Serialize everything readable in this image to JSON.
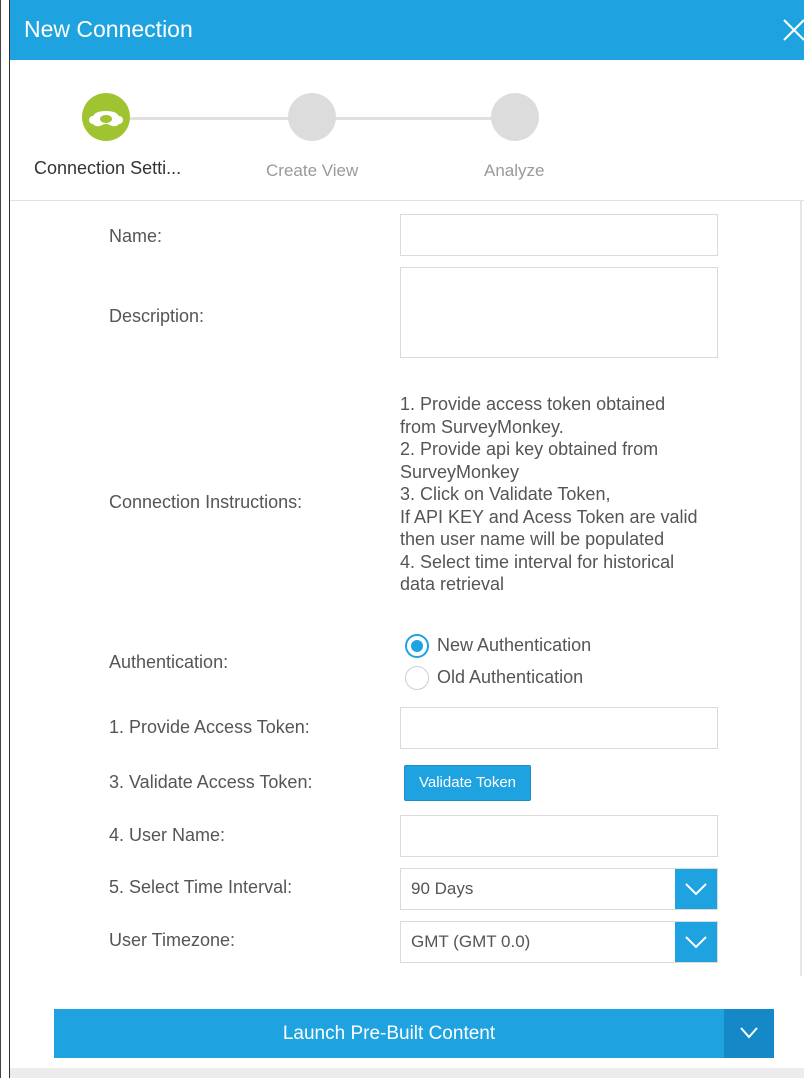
{
  "dialog": {
    "title": "New Connection",
    "accent": "#1fa3e0"
  },
  "steps": [
    {
      "label": "Connection Setti...",
      "active": true
    },
    {
      "label": "Create View",
      "active": false
    },
    {
      "label": "Analyze",
      "active": false
    }
  ],
  "form": {
    "name_label": "Name:",
    "description_label": "Description:",
    "instructions_label": "Connection Instructions:",
    "instructions_lines": [
      "1. Provide access token obtained",
      "from SurveyMonkey.",
      "2. Provide api key obtained from",
      "SurveyMonkey",
      "3. Click on Validate Token,",
      "If API KEY and Acess Token are valid",
      "then user name will be populated",
      "4. Select time interval for historical",
      "data retrieval"
    ],
    "authentication_label": "Authentication:",
    "auth_options": [
      "New Authentication",
      "Old Authentication"
    ],
    "access_token_label": "1. Provide Access Token:",
    "validate_label": "3. Validate Access Token:",
    "validate_button": "Validate Token",
    "username_label": "4. User Name:",
    "time_interval_label": "5. Select Time Interval:",
    "time_interval_value": "90 Days",
    "timezone_label": "User Timezone:",
    "timezone_value": "GMT (GMT 0.0)"
  },
  "footer": {
    "launch_label": "Launch Pre-Built Content"
  }
}
